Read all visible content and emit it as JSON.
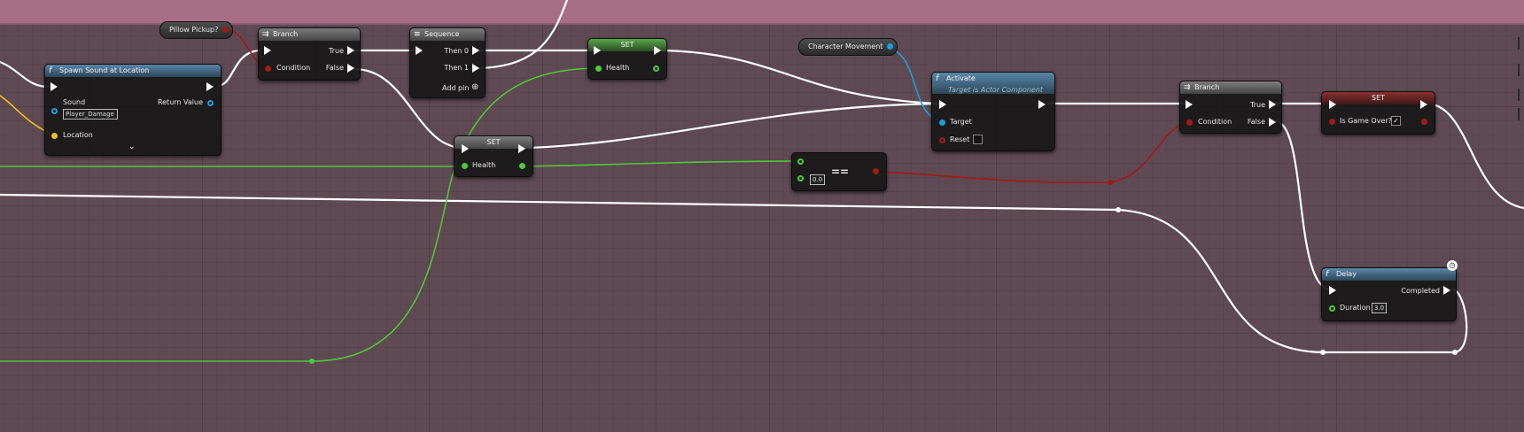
{
  "colors": {
    "canvas": "#5f4a53",
    "top_band": "#a86e86",
    "exec_wire": "#ffffff",
    "float_wire": "#4fc83a",
    "bool_wire": "#a11a1a",
    "object_wire": "#1a9fe0",
    "sound_pin": "#1a9fe0",
    "vector_pin": "#f0c020"
  },
  "nodes": {
    "pillow_pickup": {
      "label": "Pillow Pickup?"
    },
    "spawn_sound": {
      "icon": "function-icon",
      "title": "Spawn Sound at Location",
      "sound_label": "Sound",
      "sound_value": "Player_Damage",
      "return_label": "Return Value",
      "location_label": "Location",
      "expand_icon": "chevron-down-icon"
    },
    "branch1": {
      "icon": "branch-icon",
      "title": "Branch",
      "true_label": "True",
      "false_label": "False",
      "condition_label": "Condition"
    },
    "sequence": {
      "icon": "sequence-icon",
      "title": "Sequence",
      "then0": "Then 0",
      "then1": "Then 1",
      "add_pin": "Add pin",
      "add_icon": "plus-circle-icon"
    },
    "set_health_top": {
      "title": "SET",
      "var_label": "Health"
    },
    "set_health_mid": {
      "title": "SET",
      "var_label": "Health"
    },
    "equals": {
      "op": "==",
      "value": "0.0"
    },
    "char_movement": {
      "label": "Character Movement"
    },
    "activate": {
      "icon": "function-icon",
      "title": "Activate",
      "subtitle": "Target is Actor Component",
      "target_label": "Target",
      "reset_label": "Reset"
    },
    "branch2": {
      "icon": "branch-icon",
      "title": "Branch",
      "true_label": "True",
      "false_label": "False",
      "condition_label": "Condition"
    },
    "set_game_over": {
      "title": "SET",
      "var_label": "Is Game Over?",
      "checked": true
    },
    "delay": {
      "icon": "function-icon",
      "title": "Delay",
      "completed_label": "Completed",
      "duration_label": "Duration",
      "duration_value": "3.0",
      "clock_icon": "clock-icon"
    }
  }
}
